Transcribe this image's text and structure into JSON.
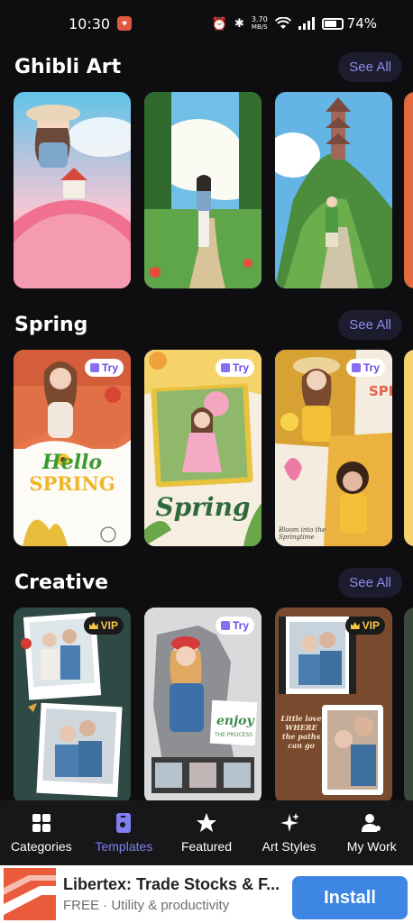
{
  "status_bar": {
    "time": "10:30",
    "net_speed_value": "3.70",
    "net_speed_unit": "MB/S",
    "battery": "74%",
    "battery_level": 0.74
  },
  "sections": [
    {
      "title": "Ghibli Art",
      "see_all": "See All"
    },
    {
      "title": "Spring",
      "see_all": "See All"
    },
    {
      "title": "Creative",
      "see_all": "See All"
    }
  ],
  "spring_cards": [
    {
      "badge": "Try",
      "text_top": "Hello",
      "text_bottom": "SPRING"
    },
    {
      "badge": "Try",
      "text": "Spring"
    },
    {
      "badge": "Try",
      "vertical_text": "SPRING",
      "caption": "Bloom into the Springtime"
    }
  ],
  "creative_cards": [
    {
      "badge": "VIP"
    },
    {
      "badge": "Try",
      "caption_top": "enjoy",
      "caption_bottom": "THE PROCESS"
    },
    {
      "badge": "VIP",
      "caption": "Little love WHERE the paths can go"
    }
  ],
  "bottom_nav": [
    {
      "label": "Categories",
      "icon": "grid-icon"
    },
    {
      "label": "Templates",
      "icon": "templates-icon"
    },
    {
      "label": "Featured",
      "icon": "star-icon"
    },
    {
      "label": "Art Styles",
      "icon": "sparkle-icon"
    },
    {
      "label": "My Work",
      "icon": "user-icon"
    }
  ],
  "ad": {
    "title": "Libertex: Trade Stocks & F...",
    "subtitle": "FREE · Utility & productivity",
    "button": "Install"
  },
  "colors": {
    "accent": "#7f7ff2",
    "see_all_bg": "#1c1c2e",
    "ad_button": "#3d86e3"
  }
}
